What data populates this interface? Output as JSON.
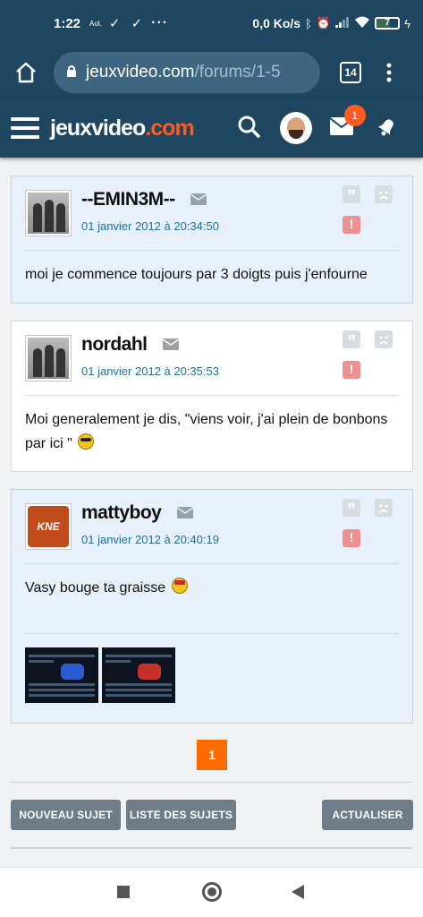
{
  "status_bar": {
    "time": "1:22",
    "carrier_tag": "Aol.",
    "checks": "✓ ✓",
    "more": "···",
    "speed": "0,0 Ko/s",
    "battery": "7"
  },
  "browser": {
    "url_host": "jeuxvideo.com",
    "url_path": "/forums/1-5",
    "tab_count": "14"
  },
  "site_header": {
    "logo_main": "jeuxvideo",
    "logo_suffix": ".com",
    "mail_badge": "1"
  },
  "posts": [
    {
      "author": "--EMIN3M--",
      "date": "01 janvier 2012 à 20:34:50",
      "message": "moi je commence toujours par 3 doigts puis j'enfourne"
    },
    {
      "author": "nordahl",
      "date": "01 janvier 2012 à 20:35:53",
      "message": "Moi generalement je dis, \"viens voir, j'ai plein de bonbons par ici \""
    },
    {
      "author": "mattyboy",
      "date": "01 janvier 2012 à 20:40:19",
      "message": "Vasy bouge ta graisse",
      "avatar_text": "KNE"
    }
  ],
  "pagination": {
    "current_page": "1"
  },
  "actions": {
    "new_topic": "NOUVEAU SUJET",
    "topic_list": "LISTE DES SUJETS",
    "refresh": "ACTUALISER"
  },
  "colors": {
    "header_bg": "#1e4660",
    "accent_orange": "#ff6a00",
    "post_highlight_bg": "#e8f0fb",
    "date_blue": "#1f6fa0",
    "button_grey": "#6e7c88"
  }
}
